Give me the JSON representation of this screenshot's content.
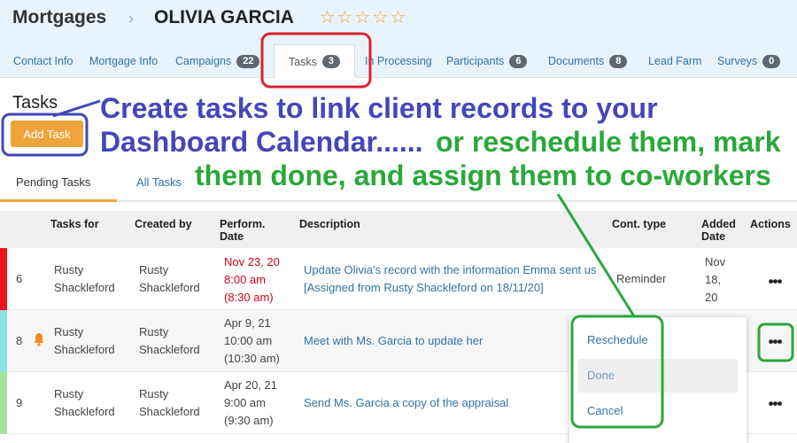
{
  "header": {
    "section": "Mortgages",
    "client_name": "OLIVIA GARCIA",
    "rating_total": 5,
    "rating_filled": 0
  },
  "tabs": [
    {
      "label": "Contact Info",
      "badge": ""
    },
    {
      "label": "Mortgage Info",
      "badge": ""
    },
    {
      "label": "Campaigns",
      "badge": "22"
    },
    {
      "label": "Tasks",
      "badge": "3"
    },
    {
      "label": "In Processing",
      "badge": ""
    },
    {
      "label": "Participants",
      "badge": "6"
    },
    {
      "label": "Documents",
      "badge": "8"
    },
    {
      "label": "Lead Farm",
      "badge": ""
    },
    {
      "label": "Surveys",
      "badge": "0"
    }
  ],
  "page": {
    "title": "Tasks",
    "add_task_label": "Add Task",
    "subtabs": [
      "Pending Tasks",
      "All Tasks"
    ]
  },
  "table": {
    "headers": [
      "Tasks for",
      "Created by",
      "Perform. Date",
      "Description",
      "Cont. type",
      "Added Date",
      "Actions"
    ],
    "rows": [
      {
        "num": "6",
        "tasks_for": "Rusty Shackleford",
        "created_by": "Rusty Shackleford",
        "perform_date": "Nov 23, 20",
        "perform_time": "8:00 am",
        "perform_end": "(8:30 am)",
        "overdue": true,
        "description": "Update Olivia's record with the information Emma sent us [Assigned from Rusty Shackleford on 18/11/20]",
        "cont_type": "Reminder",
        "added_date": "Nov 18, 20",
        "reminder": false,
        "stripe": "#e8141e"
      },
      {
        "num": "8",
        "tasks_for": "Rusty Shackleford",
        "created_by": "Rusty Shackleford",
        "perform_date": "Apr 9, 21",
        "perform_time": "10:00 am",
        "perform_end": "(10:30 am)",
        "overdue": false,
        "description": "Meet with Ms. Garcia to update her",
        "cont_type": "",
        "added_date": "",
        "reminder": true,
        "stripe": "#8fe0e6"
      },
      {
        "num": "9",
        "tasks_for": "Rusty Shackleford",
        "created_by": "Rusty Shackleford",
        "perform_date": "Apr 20, 21",
        "perform_time": "9:00 am",
        "perform_end": "(9:30 am)",
        "overdue": false,
        "description": "Send Ms. Garcia a copy of the appraisal",
        "cont_type": "",
        "added_date": "",
        "reminder": false,
        "stripe": "#a6e39a"
      }
    ]
  },
  "actions_menu": {
    "items": [
      "Reschedule",
      "Done",
      "Cancel"
    ],
    "hovered": "Done"
  },
  "annotations": {
    "blue_line1": "Create tasks to link client records to your",
    "blue_line2": "Dashboard Calendar......",
    "green_line2": "or reschedule them, mark",
    "green_line3": "them done, and assign them to co-workers"
  },
  "colors": {
    "accent_orange": "#eea43a",
    "link_blue": "#2f73a6",
    "annotation_blue": "#4347b8",
    "annotation_green": "#2aa83a",
    "highlight_red": "#d9232d",
    "overdue_red": "#d0021b"
  }
}
